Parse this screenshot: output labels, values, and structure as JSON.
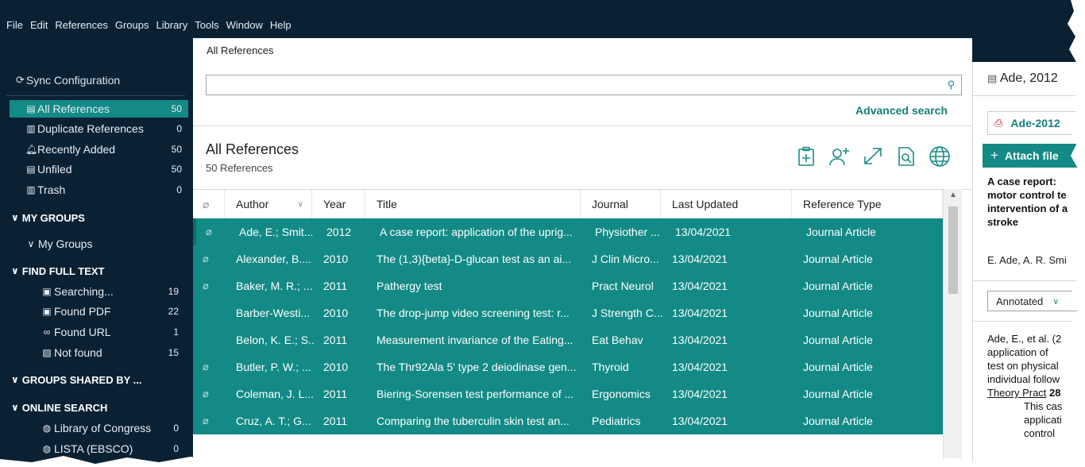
{
  "menu": [
    "File",
    "Edit",
    "References",
    "Groups",
    "Library",
    "Tools",
    "Window",
    "Help"
  ],
  "tabs": {
    "active": "All References"
  },
  "sidebar": {
    "sync": "Sync Configuration",
    "library": [
      {
        "label": "All References",
        "count": "50",
        "icon": "clipboard-icon"
      },
      {
        "label": "Duplicate References",
        "count": "0",
        "icon": "duplicate-icon"
      },
      {
        "label": "Recently Added",
        "count": "50",
        "icon": "bell-icon"
      },
      {
        "label": "Unfiled",
        "count": "50",
        "icon": "document-icon"
      },
      {
        "label": "Trash",
        "count": "0",
        "icon": "trash-icon"
      }
    ],
    "my_groups": "MY GROUPS",
    "my_groups_sub": "My Groups",
    "find_full_text": "FIND FULL TEXT",
    "fft_items": [
      {
        "label": "Searching...",
        "count": "19",
        "icon": "search-doc-icon"
      },
      {
        "label": "Found PDF",
        "count": "22",
        "icon": "pdf-doc-icon"
      },
      {
        "label": "Found URL",
        "count": "1",
        "icon": "link-icon"
      },
      {
        "label": "Not found",
        "count": "15",
        "icon": "not-found-doc-icon"
      }
    ],
    "groups_shared": "GROUPS SHARED BY ...",
    "online_search": "ONLINE SEARCH",
    "online_items": [
      {
        "label": "Library of Congress",
        "count": "0",
        "icon": "globe-icon"
      },
      {
        "label": "LISTA (EBSCO)",
        "count": "0",
        "icon": "globe-icon"
      }
    ]
  },
  "main": {
    "search_placeholder": "",
    "advanced_search": "Advanced search",
    "title": "All References",
    "count": "50 References",
    "columns": [
      "Author",
      "Year",
      "Title",
      "Journal",
      "Last Updated",
      "Reference Type"
    ],
    "rows": [
      {
        "attach": true,
        "author": "Ade, E.; Smit...",
        "year": "2012",
        "title": "A case report: application of the uprig...",
        "journal": "Physiother ...",
        "updated": "13/04/2021",
        "type": "Journal Article"
      },
      {
        "attach": true,
        "author": "Alexander, B....",
        "year": "2010",
        "title": "The (1,3){beta}-D-glucan test as an ai...",
        "journal": "J Clin Micro...",
        "updated": "13/04/2021",
        "type": "Journal Article"
      },
      {
        "attach": true,
        "author": "Baker, M. R.; ...",
        "year": "2011",
        "title": "Pathergy test",
        "journal": "Pract Neurol",
        "updated": "13/04/2021",
        "type": "Journal Article"
      },
      {
        "attach": false,
        "author": "Barber-Westi...",
        "year": "2010",
        "title": "The drop-jump video screening test: r...",
        "journal": "J Strength C...",
        "updated": "13/04/2021",
        "type": "Journal Article"
      },
      {
        "attach": false,
        "author": "Belon, K. E.; S...",
        "year": "2011",
        "title": "Measurement invariance of the Eating...",
        "journal": "Eat Behav",
        "updated": "13/04/2021",
        "type": "Journal Article"
      },
      {
        "attach": true,
        "author": "Butler, P. W.; ...",
        "year": "2010",
        "title": "The Thr92Ala 5' type 2 deiodinase gen...",
        "journal": "Thyroid",
        "updated": "13/04/2021",
        "type": "Journal Article"
      },
      {
        "attach": true,
        "author": "Coleman, J. L...",
        "year": "2011",
        "title": "Biering-Sorensen test performance of ...",
        "journal": "Ergonomics",
        "updated": "13/04/2021",
        "type": "Journal Article"
      },
      {
        "attach": true,
        "author": "Cruz, A. T.; G...",
        "year": "2011",
        "title": "Comparing the tuberculin skin test an...",
        "journal": "Pediatrics",
        "updated": "13/04/2021",
        "type": "Journal Article"
      }
    ]
  },
  "right": {
    "ref_head": "Ade, 2012",
    "pdf_name": "Ade-2012",
    "attach_label": "Attach file",
    "summary_lines": [
      "A case report:",
      "motor control te",
      "intervention of a",
      "stroke"
    ],
    "authors": "E. Ade, A. R. Smi",
    "style": "Annotated",
    "citation": {
      "l1": "Ade, E., et al. (2",
      "l2": "application of",
      "l3": "test on physical",
      "l4": "individual follow",
      "l5_link": "Theory Pract",
      "l5_bold": "28",
      "l6": "This cas",
      "l7": "applicati",
      "l8": "control"
    }
  },
  "colors": {
    "navy": "#0a2133",
    "teal": "#138a85",
    "accent": "#167f7a"
  }
}
